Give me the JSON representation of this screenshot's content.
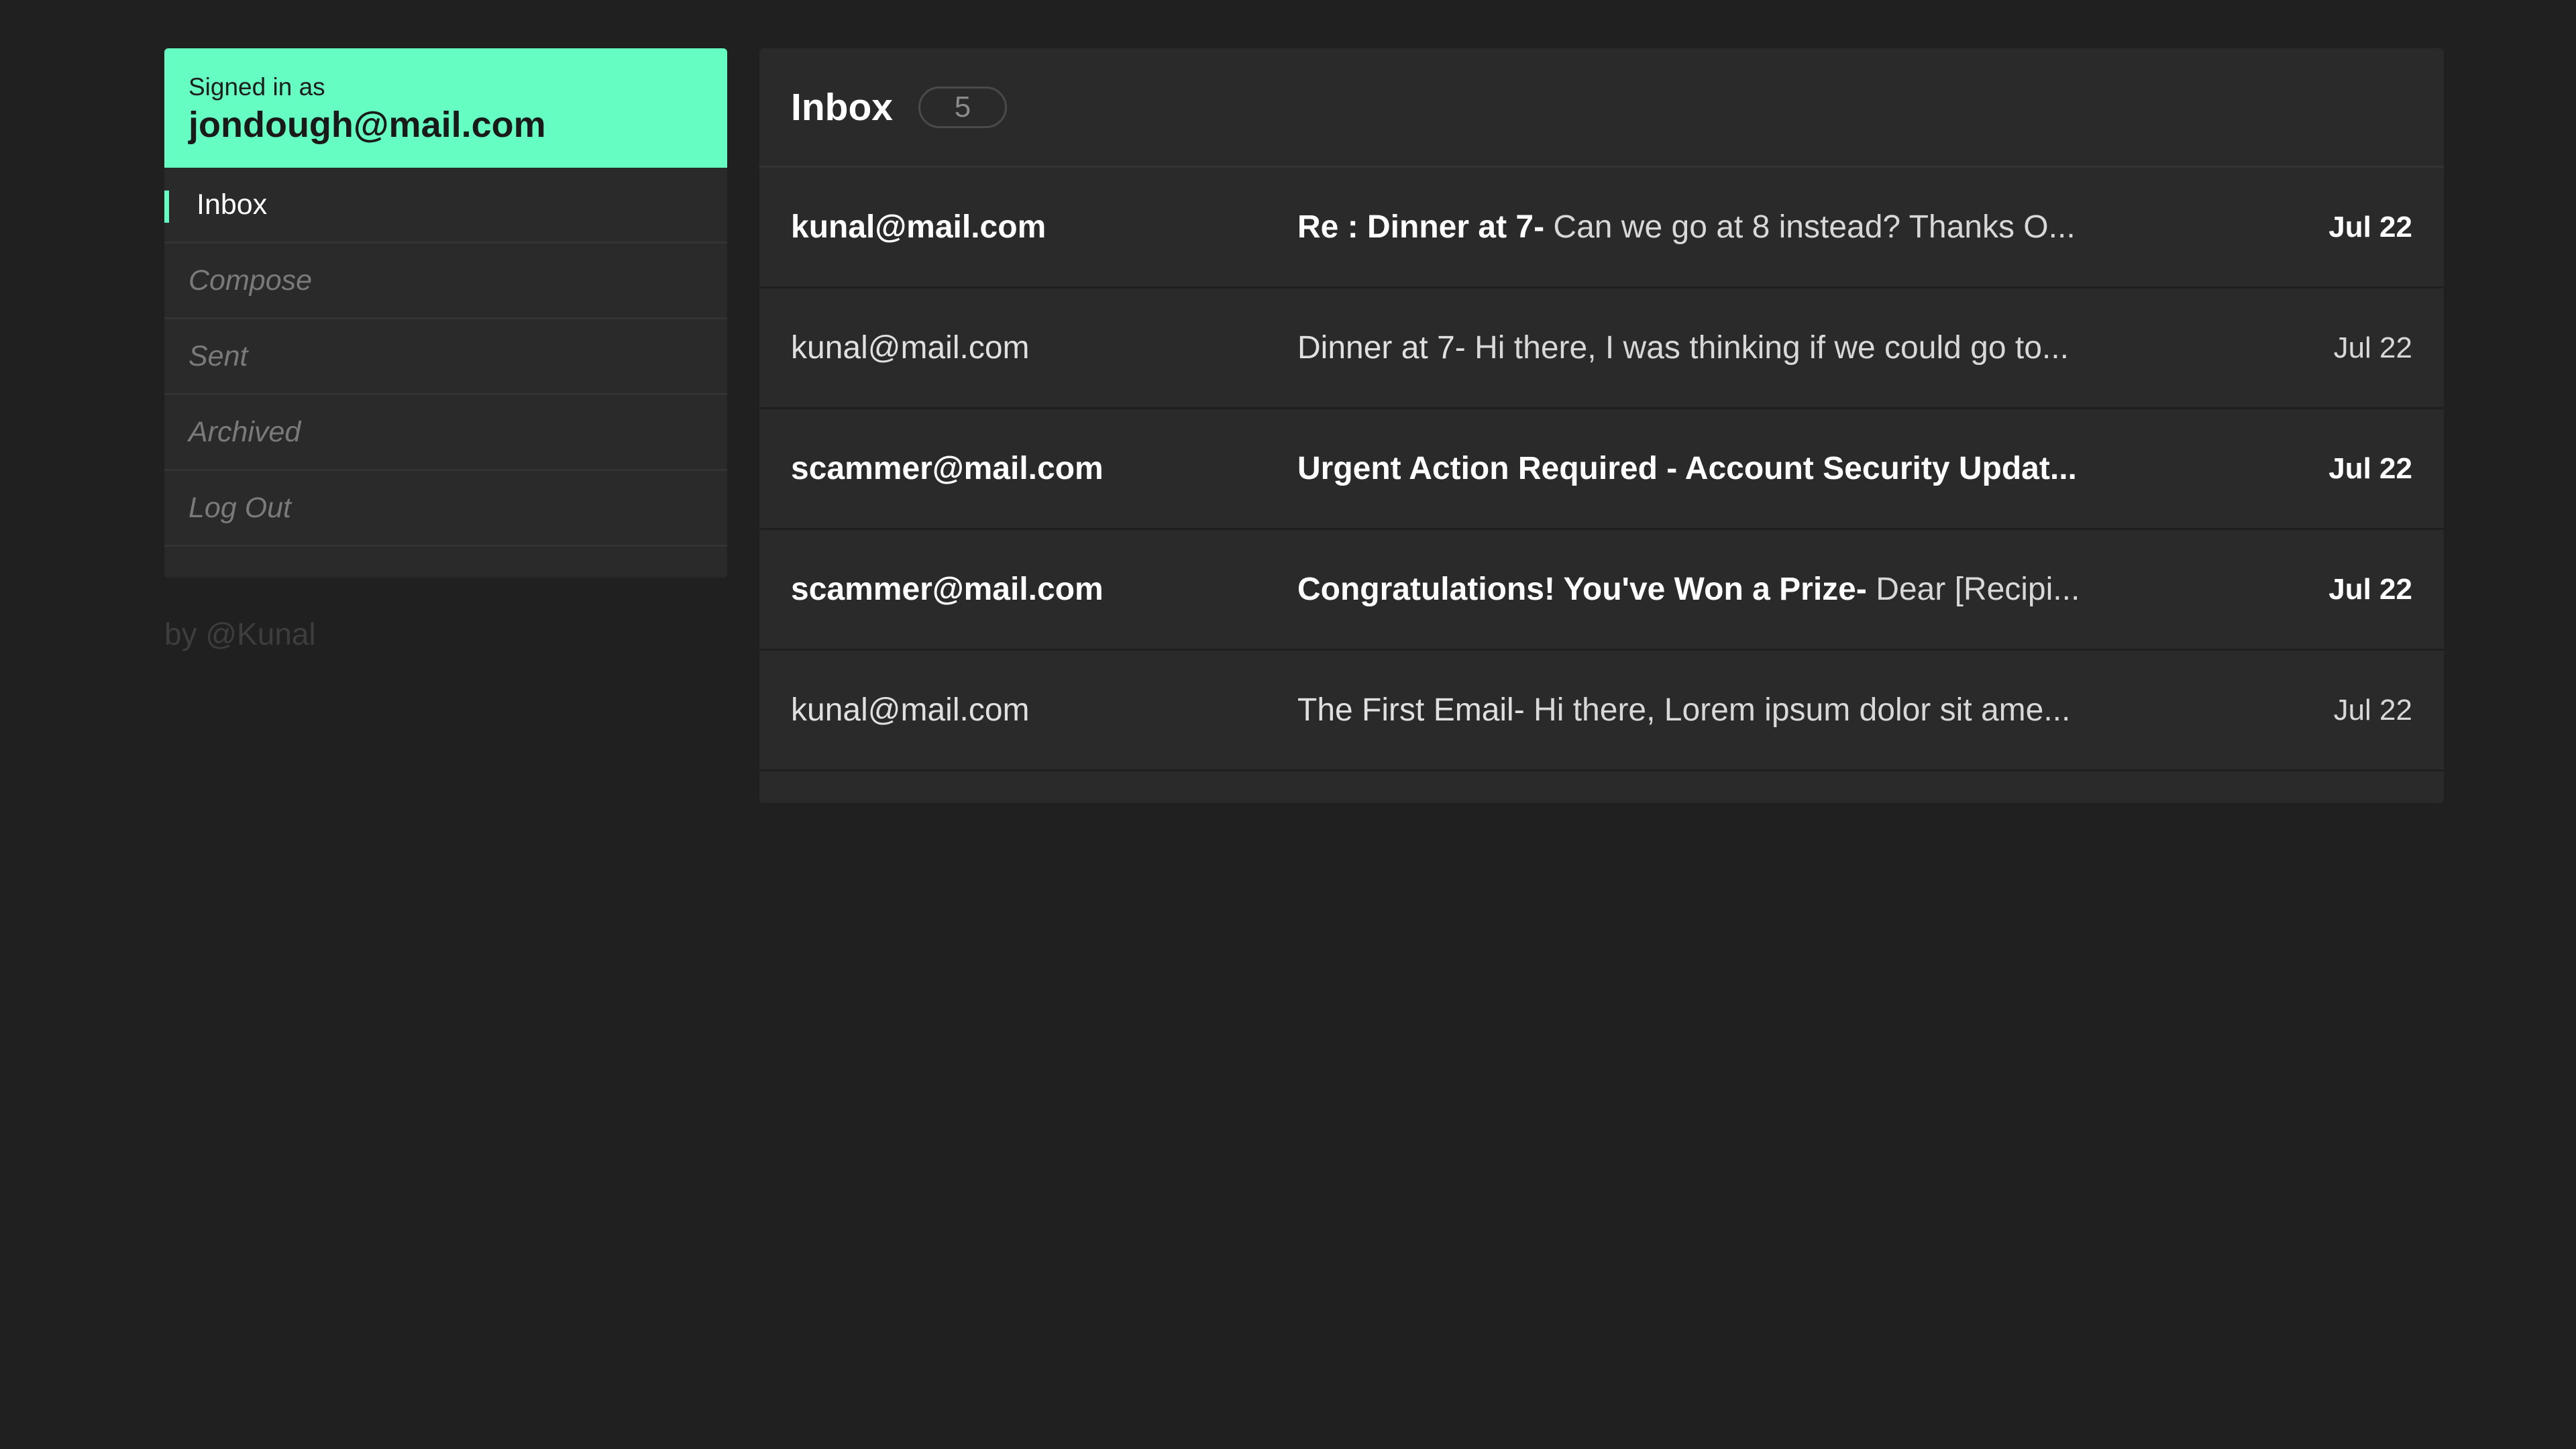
{
  "account": {
    "signed_in_label": "Signed in as",
    "email": "jondough@mail.com"
  },
  "nav": {
    "items": [
      {
        "label": "Inbox",
        "active": true
      },
      {
        "label": "Compose",
        "active": false
      },
      {
        "label": "Sent",
        "active": false
      },
      {
        "label": "Archived",
        "active": false
      },
      {
        "label": "Log Out",
        "active": false
      }
    ]
  },
  "byline": "by @Kunal",
  "inbox": {
    "title": "Inbox",
    "count": "5",
    "emails": [
      {
        "from": "kunal@mail.com",
        "subject": "Re : Dinner at 7",
        "separator": "- ",
        "preview": "Can we go at 8 instead? Thanks O...",
        "date": "Jul 22",
        "unread": true
      },
      {
        "from": "kunal@mail.com",
        "subject": "Dinner at 7",
        "separator": "- ",
        "preview": "Hi there, I was thinking if we could go to...",
        "date": "Jul 22",
        "unread": false
      },
      {
        "from": "scammer@mail.com",
        "subject": "Urgent Action Required - Account Security Updat...",
        "separator": "",
        "preview": "",
        "date": "Jul 22",
        "unread": true
      },
      {
        "from": "scammer@mail.com",
        "subject": "Congratulations! You've Won a Prize",
        "separator": "- ",
        "preview": "Dear [Recipi...",
        "date": "Jul 22",
        "unread": true
      },
      {
        "from": "kunal@mail.com",
        "subject": "The First Email",
        "separator": "- ",
        "preview": "Hi there, Lorem ipsum dolor sit ame...",
        "date": "Jul 22",
        "unread": false
      }
    ]
  },
  "colors": {
    "accent": "#65fdc1",
    "background": "#202020",
    "panel": "#2a2a2a"
  }
}
